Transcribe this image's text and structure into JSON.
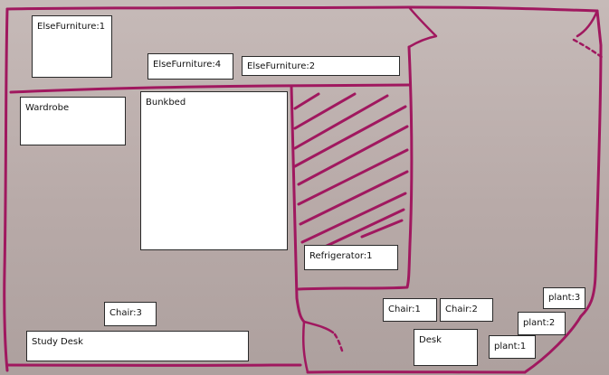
{
  "sketch": {
    "ink_color": "#a0185f",
    "paper_color": "#bdb0ae"
  },
  "labels": {
    "else_furniture_1": "ElseFurniture:1",
    "else_furniture_4": "ElseFurniture:4",
    "else_furniture_2": "ElseFurniture:2",
    "wardrobe": "Wardrobe",
    "bunkbed": "Bunkbed",
    "refrigerator_1": "Refrigerator:1",
    "chair_3": "Chair:3",
    "study_desk": "Study Desk",
    "chair_1": "Chair:1",
    "chair_2": "Chair:2",
    "desk": "Desk",
    "plant_3": "plant:3",
    "plant_2": "plant:2",
    "plant_1": "plant:1"
  }
}
